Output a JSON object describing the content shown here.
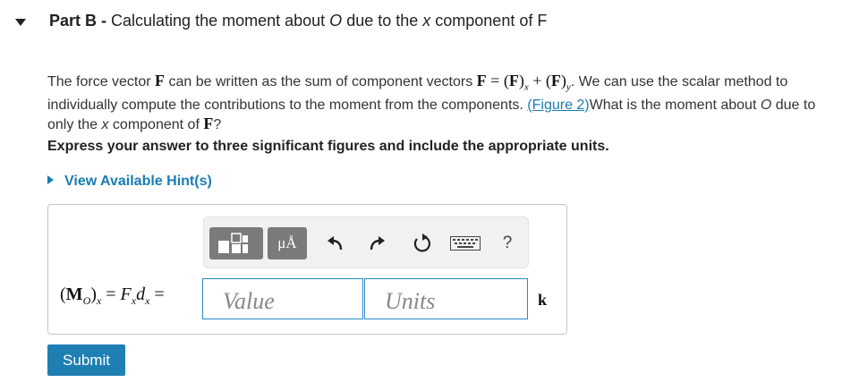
{
  "header": {
    "part_label": "Part B",
    "separator": " - ",
    "title_pre": "Calculating the moment about ",
    "title_O": "O",
    "title_mid": " due to the ",
    "title_x": "x",
    "title_post": " component of F"
  },
  "problem": {
    "p1": "The force vector ",
    "F1": "F",
    "p2": " can be written as the sum of component vectors ",
    "eq_F": "F",
    "eq_eq": " = (",
    "eq_Fx": "F",
    "eq_close_x": ")",
    "eq_sub_x": "x",
    "eq_plus": " + (",
    "eq_Fy": "F",
    "eq_close_y": ")",
    "eq_sub_y": "y",
    "p3": ". We can use the scalar method to individually compute the contributions to the moment from the components. ",
    "link": "(Figure 2)",
    "p4": "What is the moment about ",
    "O": "O",
    "p5": " due to only the ",
    "x": "x",
    "p6": " component of ",
    "F2": "F",
    "p7": "?"
  },
  "instruction": "Express your answer to three significant figures and include the appropriate units.",
  "hint": {
    "label": "View Available Hint(s)"
  },
  "toolbar": {
    "unit_symbol": "μÅ",
    "help_label": "?"
  },
  "equation": {
    "open": "(",
    "M": "M",
    "sub_O": "O",
    "close": ")",
    "sub_x": "x",
    "eq1": " = ",
    "Fx": "F",
    "Fx_sub": "x",
    "d": "d",
    "d_sub": "x",
    "eq2": " ="
  },
  "inputs": {
    "value_placeholder": "Value",
    "units_placeholder": "Units"
  },
  "unit_vector": "k",
  "submit_label": "Submit",
  "colors": {
    "link": "#1a7db5",
    "submit_bg": "#1f7fb3",
    "input_border": "#2a8bc4",
    "toolbar_btn": "#7a7a7a"
  }
}
